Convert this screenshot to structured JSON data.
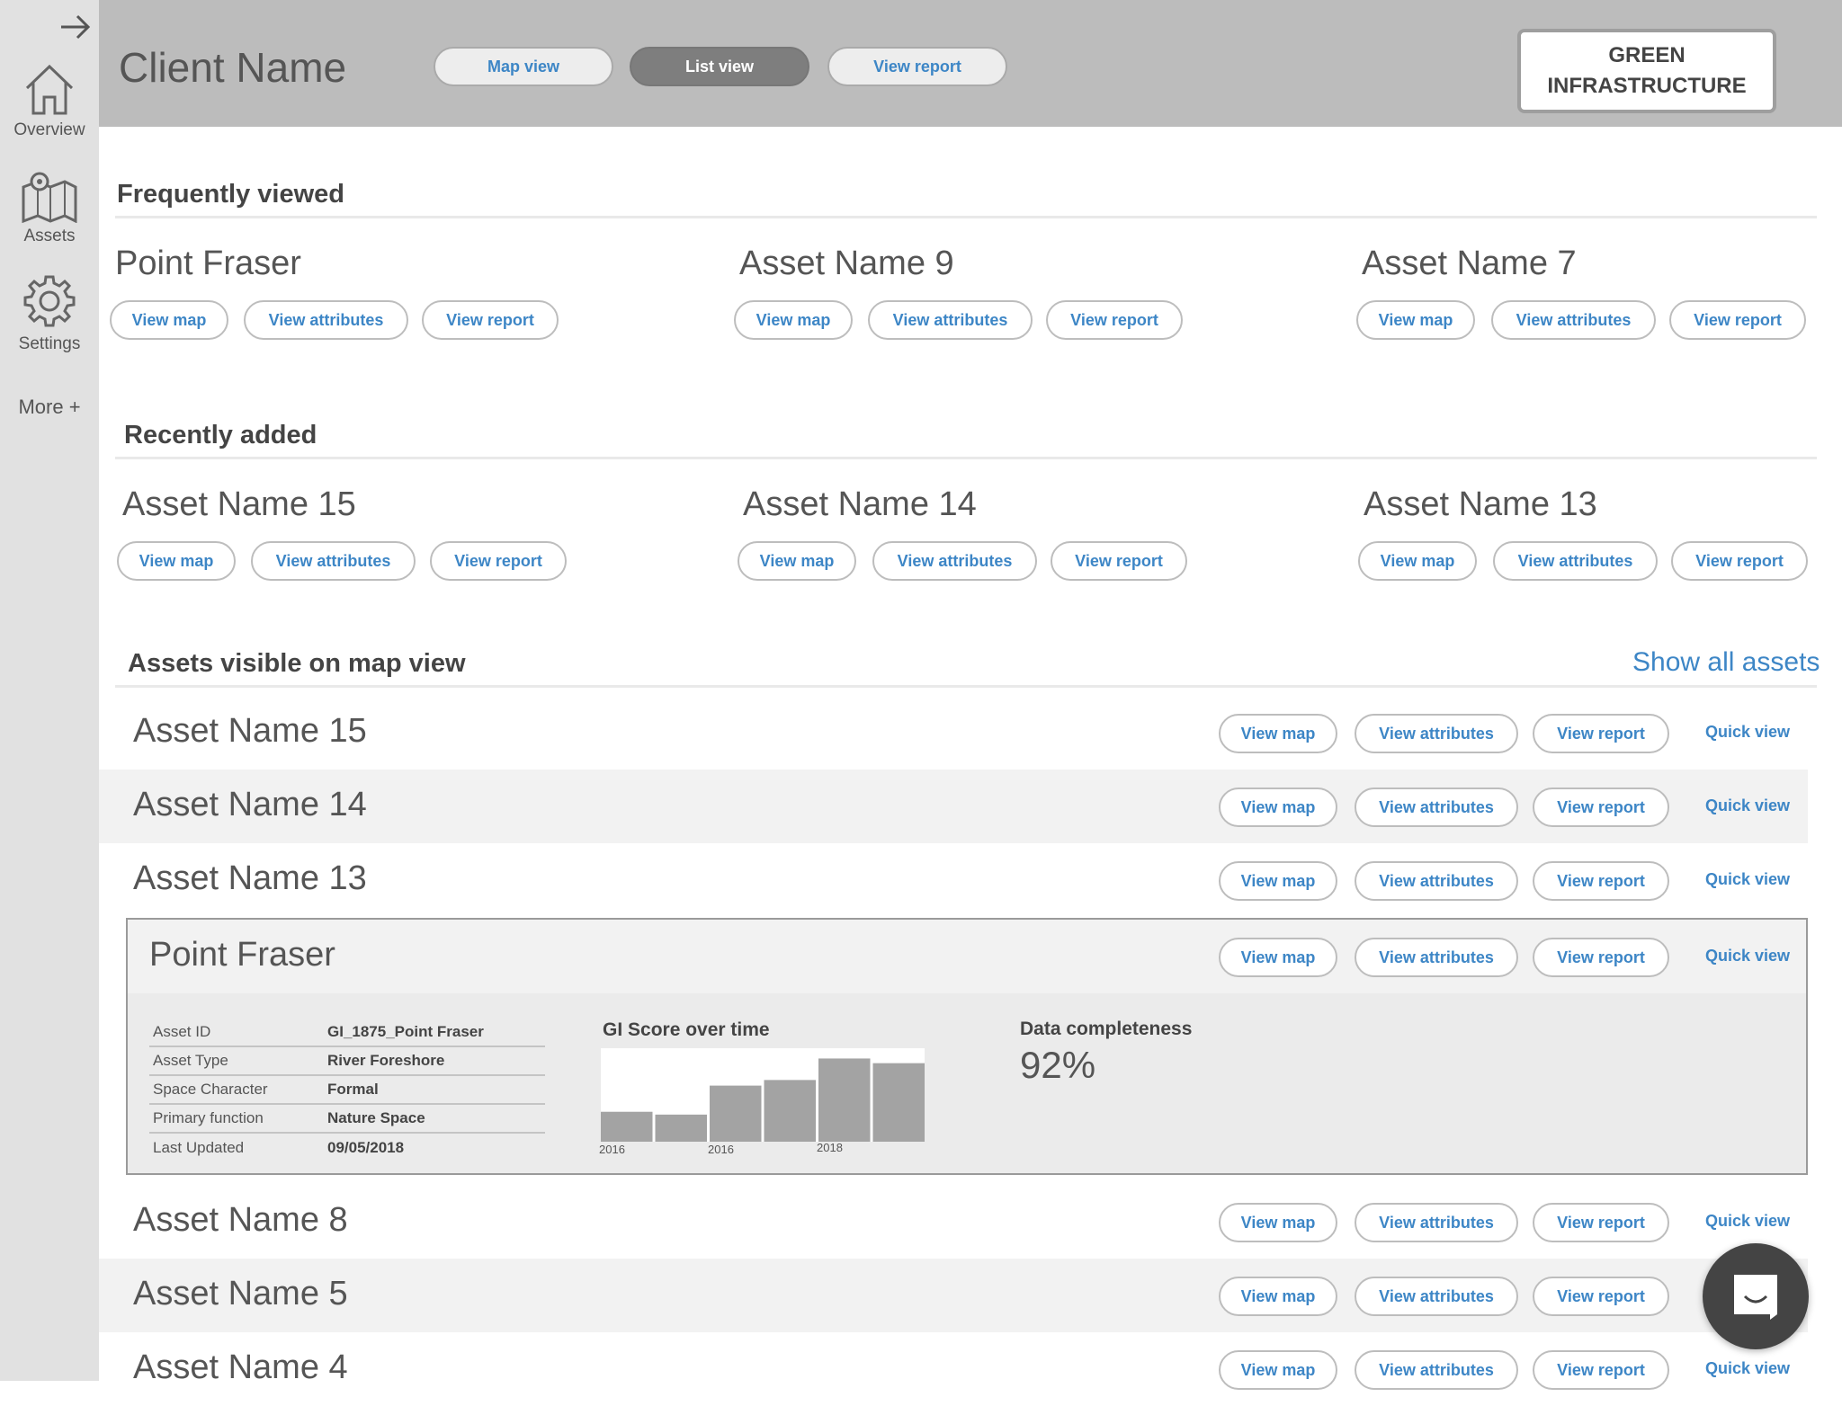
{
  "sidebar": {
    "items": [
      {
        "label": "Overview",
        "icon": "home-icon"
      },
      {
        "label": "Assets",
        "icon": "map-icon"
      },
      {
        "label": "Settings",
        "icon": "gear-icon"
      }
    ],
    "more": "More +"
  },
  "header": {
    "client_name": "Client Name",
    "tabs": [
      "Map view",
      "List view",
      "View report"
    ],
    "active_tab": "List view",
    "brand_line1": "GREEN",
    "brand_line2": "INFRASTRUCTURE"
  },
  "labels": {
    "view_map": "View map",
    "view_attributes": "View attributes",
    "view_report": "View report",
    "quick_view": "Quick view"
  },
  "frequently_viewed": {
    "title": "Frequently viewed",
    "cards": [
      "Point Fraser",
      "Asset Name 9",
      "Asset Name 7"
    ]
  },
  "recently_added": {
    "title": "Recently added",
    "cards": [
      "Asset Name 15",
      "Asset Name 14",
      "Asset Name 13"
    ]
  },
  "map_assets": {
    "title": "Assets visible on map view",
    "show_all": "Show all assets",
    "rows": [
      "Asset Name 15",
      "Asset Name 14",
      "Asset Name 13",
      "Asset Name 8",
      "Asset Name 5",
      "Asset Name 4"
    ]
  },
  "expanded": {
    "name": "Point Fraser",
    "attributes": [
      {
        "key": "Asset ID",
        "value": "GI_1875_Point Fraser"
      },
      {
        "key": "Asset Type",
        "value": "River Foreshore"
      },
      {
        "key": "Space Character",
        "value": "Formal"
      },
      {
        "key": "Primary function",
        "value": "Nature Space"
      },
      {
        "key": "Last Updated",
        "value": "09/05/2018"
      }
    ],
    "gi_title": "GI Score over time",
    "completeness_title": "Data completeness",
    "completeness_value": "92%"
  },
  "chart_data": {
    "type": "bar",
    "title": "GI Score over time",
    "tick_labels": [
      "2016",
      "2016",
      "2018"
    ],
    "values": [
      32,
      29,
      60,
      66,
      89,
      84
    ],
    "ylim": [
      0,
      100
    ],
    "grid": false,
    "legend": "none",
    "bar_color": "#a3a3a3"
  },
  "colors": {
    "accent": "#3d86c6",
    "header_bg": "#bcbcbc",
    "sidebar_bg": "#e1e1e1"
  }
}
